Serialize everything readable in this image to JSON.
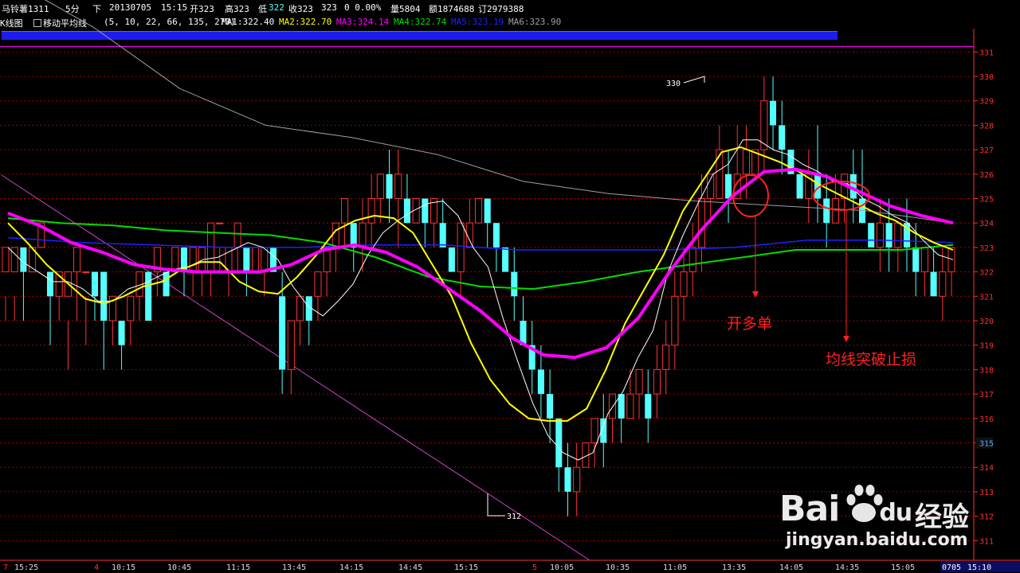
{
  "header": {
    "symbol": "马铃薯1311",
    "period": "5分",
    "direction": "下",
    "date": "20130705",
    "time": "15:15",
    "open_label": "开323",
    "high_label": "高323",
    "low_label": "低",
    "low_value": "322",
    "close_label": "收323",
    "close_value": "323",
    "change": "0 0.00%",
    "volume_label": "量5804",
    "amount_label": "额1874688",
    "order_label": "订2979388"
  },
  "indicator_bar": {
    "chart_name": "K线图",
    "indicator_name": "移动平均线",
    "params": "(5, 10, 22, 66, 135, 270)",
    "ma1": "MA1:322.40",
    "ma2": "MA2:322.70",
    "ma3": "MA3:324.14",
    "ma4": "MA4:322.74",
    "ma5": "MA5:323.19",
    "ma6": "MA6:323.90"
  },
  "colors": {
    "up_candle": "#ff3232",
    "down_candle": "#54ffff",
    "ma1": "#ffffff",
    "ma2": "#ffff00",
    "ma3": "#ff00ff",
    "ma4": "#00dd00",
    "ma5": "#2020ff",
    "ma6": "#a0a0a0",
    "grid": "#a00000",
    "axis_text": "#ff3030"
  },
  "annotations": {
    "open_long": "开多单",
    "stop_loss": "均线突破止损",
    "high_marker": "330",
    "low_marker": "312"
  },
  "price_axis": {
    "ticks": [
      "331",
      "330",
      "329",
      "328",
      "327",
      "326",
      "325",
      "324",
      "323",
      "322",
      "321",
      "320",
      "319",
      "318",
      "317",
      "316",
      "315",
      "314",
      "313",
      "312",
      "311"
    ],
    "highlight": "315"
  },
  "time_axis": {
    "labels": [
      "7",
      "15:25",
      "4",
      "10:15",
      "10:45",
      "11:15",
      "13:45",
      "14:15",
      "14:45",
      "15:15",
      "5",
      "10:05",
      "10:35",
      "11:05",
      "13:35",
      "14:05",
      "14:35",
      "15:05"
    ],
    "current_date": "0705",
    "current_time": "15:10"
  },
  "watermark": {
    "brand": "Bai",
    "brand_tail": "du",
    "product": "经验",
    "url": "jingyan.baidu.com"
  },
  "chart_data": {
    "type": "candlestick",
    "ylim": [
      310.5,
      331.5
    ],
    "candles": [
      [
        322,
        323,
        321,
        320
      ],
      [
        322,
        323,
        321,
        320
      ],
      [
        323,
        322,
        323,
        320
      ],
      [
        322,
        323,
        320,
        320
      ],
      [
        323,
        324,
        322,
        322
      ],
      [
        322,
        321,
        322,
        319
      ],
      [
        321,
        322,
        321,
        320
      ],
      [
        321,
        322,
        320,
        318
      ],
      [
        322,
        323,
        322,
        320
      ],
      [
        322,
        322,
        321,
        319
      ],
      [
        322,
        321,
        322,
        320
      ],
      [
        322,
        320,
        320,
        318
      ],
      [
        320,
        321,
        321,
        319
      ],
      [
        320,
        319,
        320,
        318
      ],
      [
        320,
        321,
        321,
        319
      ],
      [
        321,
        322,
        322,
        320
      ],
      [
        322,
        320,
        322,
        320
      ],
      [
        322,
        323,
        322,
        321
      ],
      [
        322,
        321,
        322,
        321
      ],
      [
        322,
        323,
        322,
        322
      ],
      [
        323,
        322,
        323,
        321
      ],
      [
        322,
        323,
        322,
        321
      ],
      [
        322,
        323,
        323,
        321
      ],
      [
        322,
        324,
        324,
        321
      ],
      [
        324,
        324,
        323,
        322
      ],
      [
        322,
        323,
        322,
        321
      ],
      [
        323,
        324,
        324,
        322
      ],
      [
        323,
        322,
        323,
        321
      ],
      [
        322,
        323,
        323,
        322
      ],
      [
        322,
        323,
        323,
        321
      ],
      [
        323,
        322,
        323,
        322
      ],
      [
        321,
        318,
        322,
        317
      ],
      [
        318,
        320,
        320,
        317
      ],
      [
        320,
        321,
        321,
        319
      ],
      [
        321,
        320,
        321,
        319
      ],
      [
        321,
        322,
        322,
        320
      ],
      [
        322,
        323,
        323,
        321
      ],
      [
        323,
        324,
        324,
        322
      ],
      [
        324,
        325,
        325,
        323
      ],
      [
        324,
        323,
        324,
        322
      ],
      [
        323,
        324,
        325,
        322
      ],
      [
        324,
        325,
        326,
        323
      ],
      [
        325,
        326,
        326,
        324
      ],
      [
        326,
        325,
        327,
        324
      ],
      [
        325,
        326,
        327,
        323
      ],
      [
        325,
        324,
        326,
        324
      ],
      [
        324,
        325,
        325,
        324
      ],
      [
        325,
        324,
        325,
        323
      ],
      [
        324,
        325,
        325,
        323
      ],
      [
        324,
        323,
        325,
        323
      ],
      [
        323,
        322,
        323,
        322
      ],
      [
        322,
        324,
        324,
        321
      ],
      [
        323,
        324,
        325,
        323
      ],
      [
        324,
        325,
        325,
        324
      ],
      [
        325,
        324,
        325,
        323
      ],
      [
        324,
        323,
        324,
        322
      ],
      [
        323,
        322,
        323,
        322
      ],
      [
        322,
        321,
        323,
        320
      ],
      [
        320,
        319,
        321,
        319
      ],
      [
        319,
        318,
        320,
        317
      ],
      [
        318,
        317,
        319,
        316
      ],
      [
        317,
        316,
        318,
        315
      ],
      [
        316,
        314,
        316,
        313
      ],
      [
        314,
        313,
        315,
        312
      ],
      [
        313,
        314,
        315,
        312
      ],
      [
        314,
        315,
        315,
        314
      ],
      [
        315,
        316,
        316,
        314
      ],
      [
        316,
        315,
        317,
        314
      ],
      [
        316,
        317,
        317,
        315
      ],
      [
        317,
        316,
        317,
        315
      ],
      [
        316,
        317,
        318,
        316
      ],
      [
        317,
        318,
        318,
        316
      ],
      [
        317,
        316,
        318,
        315
      ],
      [
        317,
        318,
        319,
        316
      ],
      [
        318,
        319,
        320,
        317
      ],
      [
        319,
        321,
        322,
        318
      ],
      [
        321,
        322,
        323,
        320
      ],
      [
        322,
        323,
        324,
        321
      ],
      [
        323,
        325,
        326,
        322
      ],
      [
        325,
        326,
        326,
        324
      ],
      [
        325,
        327,
        328,
        325
      ],
      [
        326,
        325,
        327,
        324
      ],
      [
        325,
        326,
        328,
        325
      ],
      [
        326,
        327,
        328,
        325
      ],
      [
        326,
        327,
        327,
        326
      ],
      [
        327,
        329,
        330,
        326
      ],
      [
        329,
        328,
        330,
        327
      ],
      [
        328,
        327,
        329,
        326
      ],
      [
        327,
        326,
        327,
        326
      ],
      [
        326,
        325,
        326,
        325
      ],
      [
        325,
        326,
        327,
        324
      ],
      [
        326,
        325,
        328,
        324
      ],
      [
        325,
        324,
        326,
        323
      ],
      [
        324,
        325,
        326,
        324
      ],
      [
        325,
        326,
        326,
        324
      ],
      [
        326,
        325,
        327,
        324
      ],
      [
        325,
        324,
        327,
        324
      ],
      [
        324,
        323,
        324,
        323
      ],
      [
        323,
        324,
        325,
        322
      ],
      [
        324,
        323,
        325,
        322
      ],
      [
        323,
        324,
        324,
        322
      ],
      [
        324,
        323,
        325,
        322
      ],
      [
        323,
        322,
        324,
        321
      ],
      [
        322,
        323,
        323,
        321
      ],
      [
        322,
        321,
        323,
        321
      ],
      [
        321,
        322,
        323,
        320
      ],
      [
        322,
        323,
        323,
        321
      ]
    ],
    "ma_lines": {
      "MA1": [
        323,
        322.4,
        322,
        321.6,
        321.6,
        321.3,
        320.8,
        320.8,
        321.3,
        321.5,
        321.8,
        322.1,
        322.2,
        322.5,
        322.6,
        322.9,
        323.2,
        323,
        322.5,
        321.4,
        320.6,
        320.2,
        320.8,
        321.5,
        322.7,
        323.6,
        324.1,
        324.5,
        324.8,
        324.9,
        324.3,
        323,
        322.2,
        320.1,
        318.3,
        316.6,
        315.3,
        314.6,
        314.3,
        314.6,
        316.2,
        317.1,
        318.5,
        319.6,
        322,
        323.5,
        324.8,
        326,
        326.4,
        327.4,
        327.4,
        327,
        326.8,
        326.4,
        326.1,
        325.7,
        325.6,
        325,
        324.7,
        324.3,
        324,
        323.3,
        322.7,
        322.5
      ],
      "MA2": [
        324,
        323.2,
        322.3,
        321.6,
        320.9,
        320.7,
        321,
        321.4,
        321.6,
        322.1,
        322.4,
        322.4,
        321.6,
        321.2,
        321.1,
        321.8,
        322.7,
        323.7,
        324.1,
        324.3,
        324.2,
        323.6,
        322.3,
        321,
        319.1,
        317.6,
        316.6,
        316,
        315.9,
        315.9,
        316.4,
        318,
        319.9,
        321.3,
        322.7,
        324.5,
        325.7,
        326.9,
        327.1,
        326.8,
        326.5,
        326.1,
        325.6,
        325.2,
        324.8,
        324.4,
        324.1,
        323.6,
        323.2,
        322.9
      ],
      "MA3": [
        324.4,
        323.9,
        323.2,
        322.8,
        322.3,
        322.1,
        322,
        322,
        322,
        322.3,
        322.9,
        323.1,
        322.8,
        322.2,
        321.3,
        320.4,
        319.3,
        318.6,
        318.5,
        318.9,
        320.1,
        322,
        323.7,
        325.1,
        326.1,
        326.2,
        325.9,
        325.3,
        324.7,
        324.3,
        324
      ],
      "MA4": [
        324.2,
        324,
        323.9,
        323.7,
        323.6,
        323.5,
        323.2,
        322.6,
        321.8,
        321.4,
        321.3,
        321.6,
        322,
        322.3,
        322.6,
        322.9,
        322.9,
        322.9,
        323.1
      ],
      "MA5": [
        323.4,
        323.2,
        323.1,
        323,
        323,
        323.1,
        323.1,
        322.9,
        322.9,
        322.9,
        323,
        323.3,
        323.3,
        323.2
      ],
      "MA6": [
        334,
        332,
        329.5,
        328,
        327.5,
        326.8,
        325.7,
        325.2,
        324.9,
        324.7,
        324.5,
        324
      ]
    }
  }
}
